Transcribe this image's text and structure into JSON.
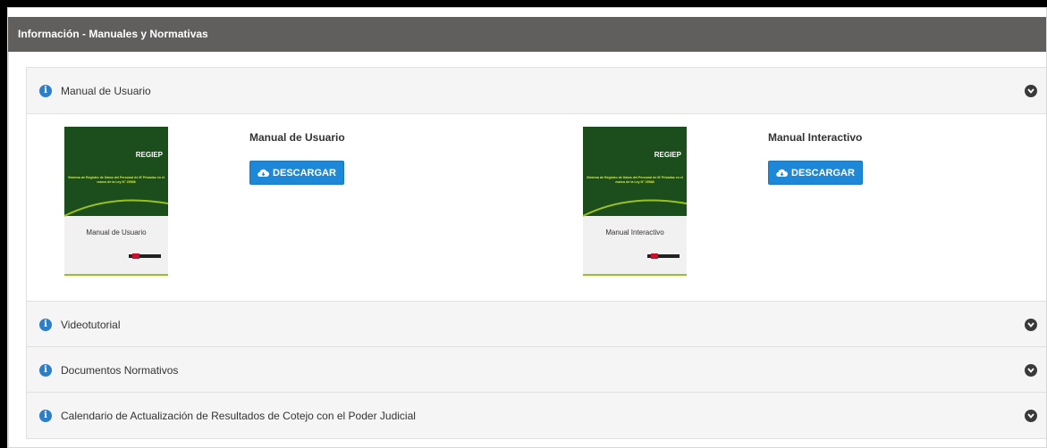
{
  "header": {
    "title": "Información - Manuales y Normativas"
  },
  "sections": [
    {
      "title": "Manual de Usuario",
      "expanded": true
    },
    {
      "title": "Videotutorial",
      "expanded": false
    },
    {
      "title": "Documentos Normativos",
      "expanded": false
    },
    {
      "title": "Calendario de Actualización de Resultados de Cotejo con el Poder Judicial",
      "expanded": false
    }
  ],
  "manuals": [
    {
      "title": "Manual de Usuario",
      "button": "DESCARGAR",
      "cover": {
        "brand": "REGIEP",
        "subtitle": "Sistema de Registro de Datos del Personal de IE Privadas en el marco de la Ley N° 29988",
        "label": "Manual de Usuario"
      }
    },
    {
      "title": "Manual Interactivo",
      "button": "DESCARGAR",
      "cover": {
        "brand": "REGIEP",
        "subtitle": "Sistema de Registro de Datos del Personal de IE Privadas en el marco de la Ley N° 29988",
        "label": "Manual Interactivo"
      }
    }
  ],
  "icons": {
    "section": "info-icon",
    "toggle": "chevron-down-icon",
    "download": "cloud-download-icon"
  },
  "colors": {
    "header": "#615f5d",
    "button": "#1e88d8",
    "info": "#2c7ec8",
    "cover": "#1c4d1c",
    "accent": "#9ac21c"
  }
}
